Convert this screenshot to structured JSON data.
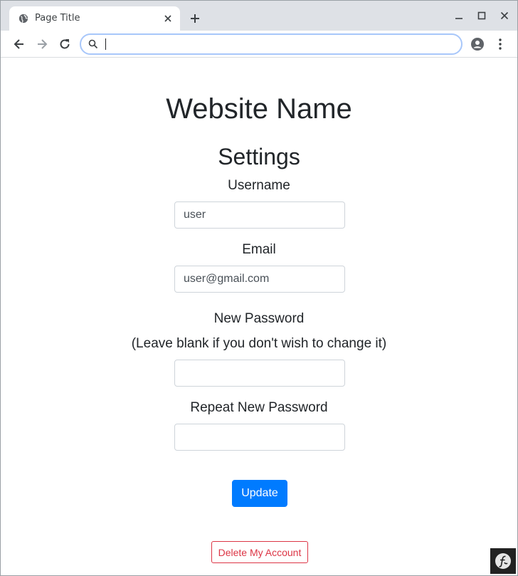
{
  "browser": {
    "tab_title": "Page Title",
    "tab_favicon_icon": "globe-icon",
    "close_icon": "close-icon",
    "newtab_icon": "plus-icon",
    "address_value": "",
    "address_placeholder": ""
  },
  "page": {
    "site_name": "Website Name",
    "heading": "Settings",
    "username_label": "Username",
    "username_value": "user",
    "email_label": "Email",
    "email_value": "user@gmail.com",
    "new_password_label": "New Password",
    "new_password_hint": "(Leave blank if you don't wish to change it)",
    "repeat_password_label": "Repeat New Password",
    "update_label": "Update",
    "delete_label": "Delete My Account"
  },
  "colors": {
    "primary": "#007bff",
    "danger": "#dc3545",
    "text": "#212529"
  }
}
